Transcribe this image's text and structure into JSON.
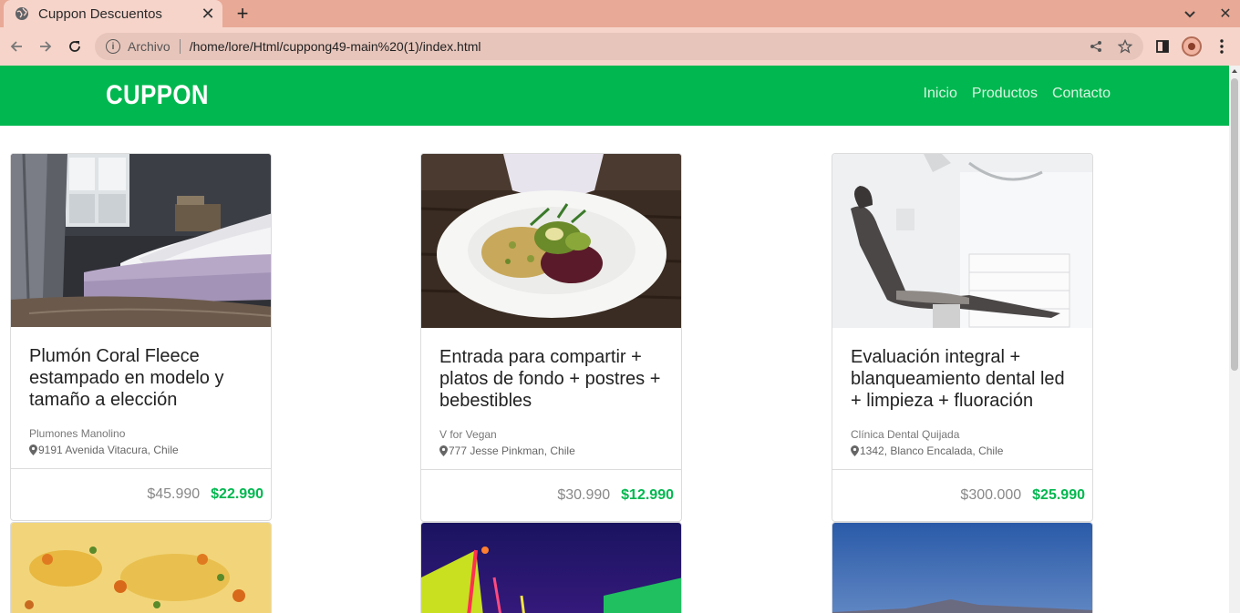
{
  "browser": {
    "tab_title": "Cuppon Descuentos",
    "new_tab_symbol": "+",
    "scheme_label": "Archivo",
    "url": "/home/lore/Html/cuppong49-main%20(1)/index.html"
  },
  "site": {
    "brand": "CUPPON",
    "nav": [
      "Inicio",
      "Productos",
      "Contacto"
    ],
    "accent_color": "#00b84f"
  },
  "products": [
    {
      "title": "Plumón Coral Fleece estampado en modelo y tamaño a elección",
      "store": "Plumones Manolino",
      "address": "9191 Avenida Vitacura, Chile",
      "old_price": "$45.990",
      "new_price": "$22.990",
      "image": "bedroom-photo"
    },
    {
      "title": "Entrada para compartir + platos de fondo + postres + bebestibles",
      "store": "V for Vegan",
      "address": "777 Jesse Pinkman, Chile",
      "old_price": "$30.990",
      "new_price": "$12.990",
      "image": "salad-photo"
    },
    {
      "title": "Evaluación integral + blanqueamiento dental led + limpieza + fluoración",
      "store": "Clínica Dental Quijada",
      "address": "1342, Blanco Encalada, Chile",
      "old_price": "$300.000",
      "new_price": "$25.990",
      "image": "dental-chair-photo"
    }
  ],
  "more_products": [
    {
      "image": "food-photo"
    },
    {
      "image": "fair-lights-photo"
    },
    {
      "image": "mountain-photo"
    }
  ]
}
